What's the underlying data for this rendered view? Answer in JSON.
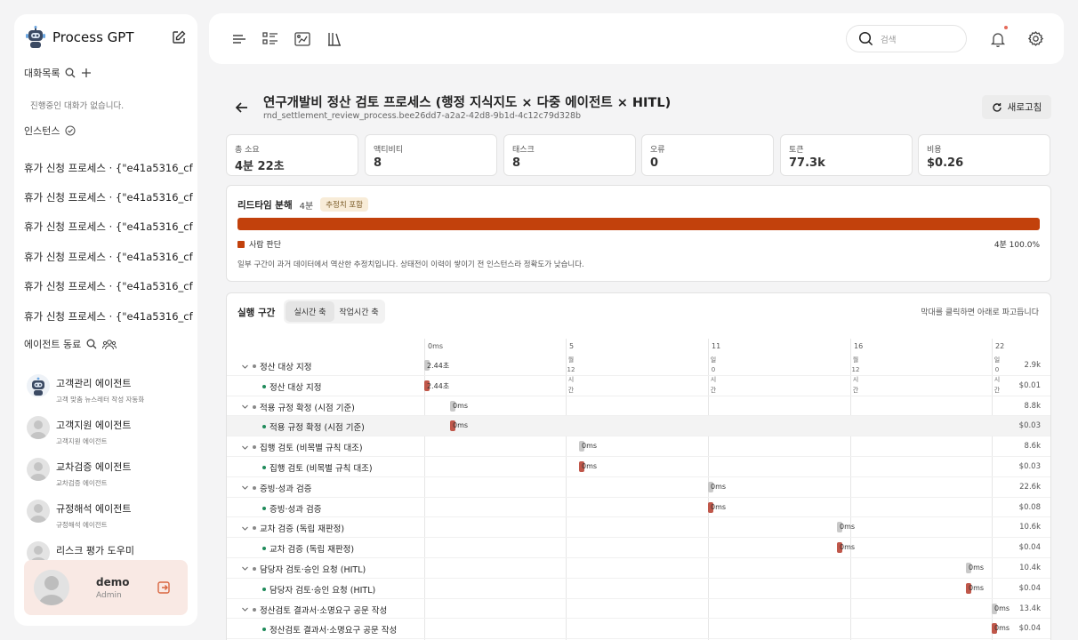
{
  "app": {
    "title": "Process GPT",
    "conversations_label": "대화목록",
    "conversations_empty": "진행중인 대화가 없습니다.",
    "instances_label": "인스턴스",
    "agents_label": "에이전트 동료"
  },
  "instances": [
    "휴가 신청 프로세스 · {\"e41a5316_cfd0...",
    "휴가 신청 프로세스 · {\"e41a5316_cfd0...",
    "휴가 신청 프로세스 · {\"e41a5316_cfd0...",
    "휴가 신청 프로세스 · {\"e41a5316_cfd0...",
    "휴가 신청 프로세스 · {\"e41a5316_cfd0...",
    "휴가 신청 프로세스 · {\"e41a5316_cfd0..."
  ],
  "agents": [
    {
      "name": "고객관리 에이전트",
      "desc": "고객 맞춤 뉴스레터 작성 자동화",
      "icon": "robot-avatar"
    },
    {
      "name": "고객지원 에이전트",
      "desc": "고객지원 에이전트",
      "icon": "person-avatar"
    },
    {
      "name": "교차검증 에이전트",
      "desc": "교차검증 에이전트",
      "icon": "person-avatar"
    },
    {
      "name": "규정해석 에이전트",
      "desc": "규정해석 에이전트",
      "icon": "person-avatar"
    },
    {
      "name": "리스크 평가 도우미",
      "desc": "",
      "icon": "person-avatar"
    }
  ],
  "user": {
    "name": "demo",
    "role": "Admin"
  },
  "search": {
    "placeholder": "검색"
  },
  "page": {
    "title": "연구개발비 정산 검토 프로세스 (행정 지식지도 × 다중 에이전트 × HITL)",
    "subtitle": "rnd_settlement_review_process.bee26dd7-a2a2-42d8-9b1d-4c12c79d328b",
    "refresh_label": "새로고침"
  },
  "stats": [
    {
      "label": "총 소요",
      "value": "4분 22초"
    },
    {
      "label": "액티비티",
      "value": "8"
    },
    {
      "label": "태스크",
      "value": "8"
    },
    {
      "label": "오류",
      "value": "0"
    },
    {
      "label": "토큰",
      "value": "77.3k"
    },
    {
      "label": "비용",
      "value": "$0.26"
    }
  ],
  "leadtime": {
    "title": "리드타임 분해",
    "duration": "4분",
    "badge": "추정치 포함",
    "legend_label": "사람 판단",
    "legend_value": "4분  100.0%",
    "share": 1.0,
    "note": "일부 구간이 과거 데이터에서 역산한 추정치입니다. 상태전이 이력이 쌓이기 전 인스턴스라 정확도가 낮습니다.",
    "color": "#c2410c"
  },
  "execution": {
    "title": "실행 구간",
    "tabs": [
      "실시간 축",
      "작업시간 축"
    ],
    "active_tab": 0,
    "hint": "막대를 클릭하면 아래로 파고듭니다",
    "ticks": [
      "0ms",
      "5",
      "11",
      "16",
      "22"
    ],
    "tick_sub": [
      "월",
      "12",
      "시",
      "간"
    ],
    "tick_sub_b": [
      "일",
      "0",
      "시",
      "간"
    ],
    "rows": [
      {
        "label": "정산 대상 지정",
        "level": 0,
        "duration": "2.44초",
        "right": "2.9k"
      },
      {
        "label": "정산 대상 지정",
        "level": 1,
        "duration": "2.44초",
        "right": "$0.01"
      },
      {
        "label": "적용 규정 확정 (시점 기준)",
        "level": 0,
        "duration": "0ms",
        "right": "8.8k"
      },
      {
        "label": "적용 규정 확정 (시점 기준)",
        "level": 1,
        "duration": "0ms",
        "right": "$0.03"
      },
      {
        "label": "집행 검토 (비목별 규칙 대조)",
        "level": 0,
        "duration": "0ms",
        "right": "8.6k"
      },
      {
        "label": "집행 검토 (비목별 규칙 대조)",
        "level": 1,
        "duration": "0ms",
        "right": "$0.03"
      },
      {
        "label": "증빙·성과 검증",
        "level": 0,
        "duration": "0ms",
        "right": "22.6k"
      },
      {
        "label": "증빙·성과 검증",
        "level": 1,
        "duration": "0ms",
        "right": "$0.08"
      },
      {
        "label": "교차 검증 (독립 재판정)",
        "level": 0,
        "duration": "0ms",
        "right": "10.6k"
      },
      {
        "label": "교차 검증 (독립 재판정)",
        "level": 1,
        "duration": "0ms",
        "right": "$0.04"
      },
      {
        "label": "담당자 검토·승인 요청 (HITL)",
        "level": 0,
        "duration": "0ms",
        "right": "10.4k"
      },
      {
        "label": "담당자 검토·승인 요청 (HITL)",
        "level": 1,
        "duration": "0ms",
        "right": "$0.04"
      },
      {
        "label": "정산검토 결과서·소명요구 공문 작성",
        "level": 0,
        "duration": "0ms",
        "right": "13.4k"
      },
      {
        "label": "정산검토 결과서·소명요구 공문 작성",
        "level": 1,
        "duration": "0ms",
        "right": "$0.04"
      }
    ]
  }
}
